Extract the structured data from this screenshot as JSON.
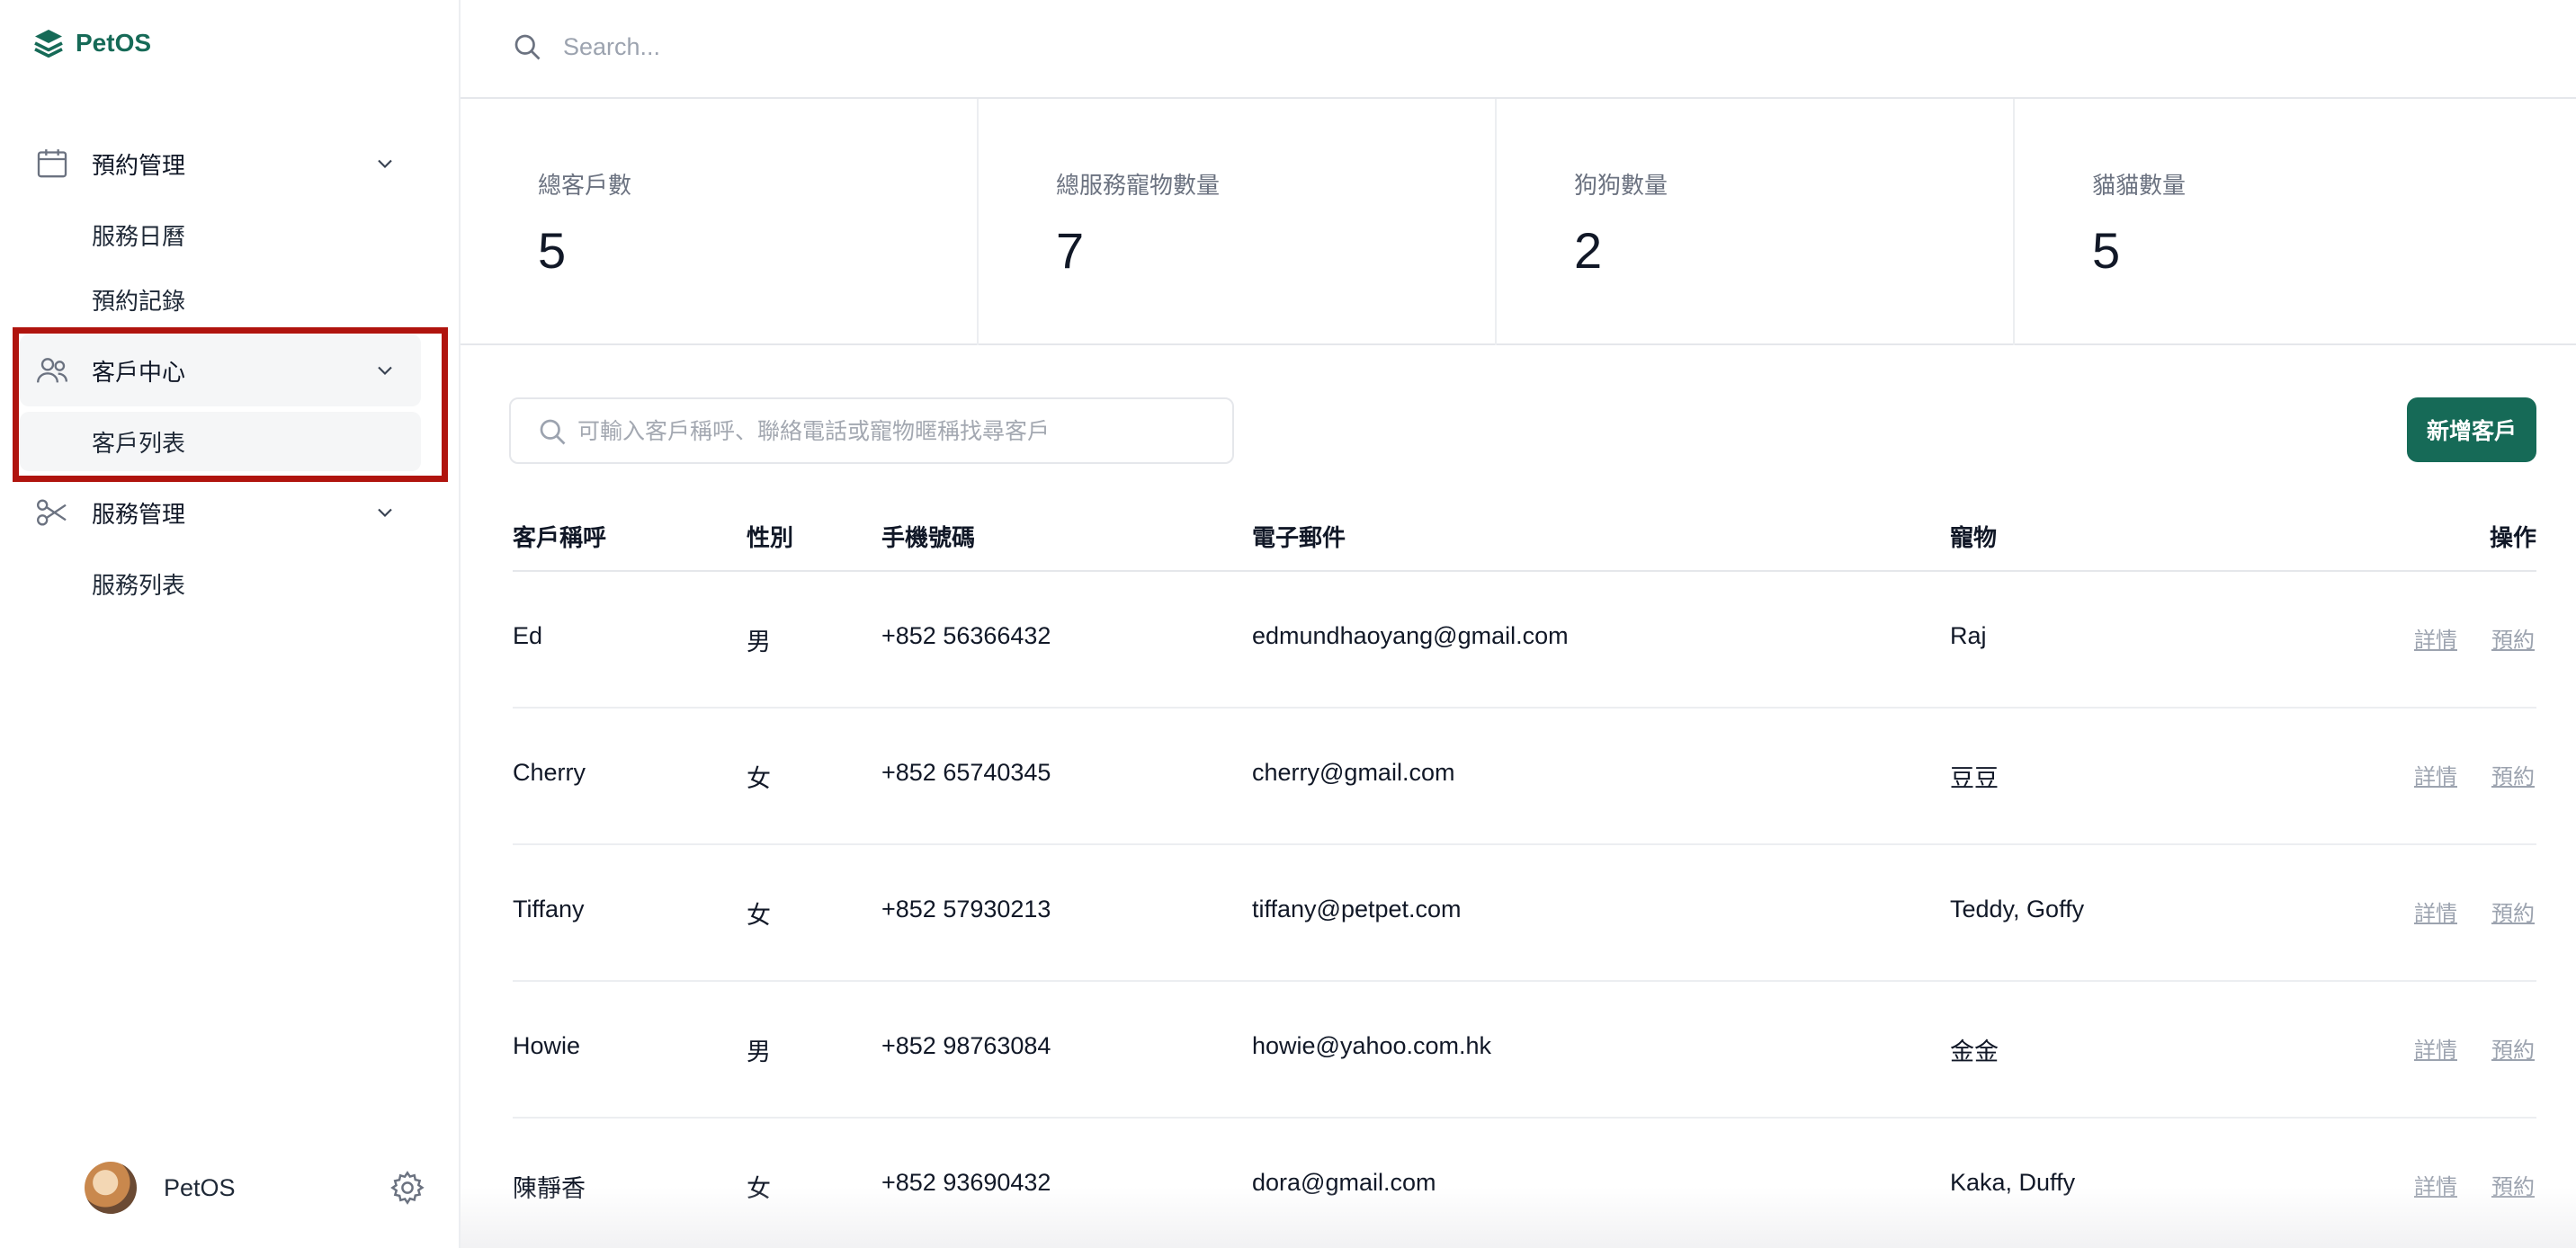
{
  "app": {
    "name": "PetOS"
  },
  "sidebar": {
    "groups": [
      {
        "label": "預約管理",
        "icon": "calendar-icon",
        "items": [
          "服務日曆",
          "預約記錄"
        ]
      },
      {
        "label": "客戶中心",
        "icon": "users-icon",
        "items": [
          "客戶列表"
        ]
      },
      {
        "label": "服務管理",
        "icon": "scissors-icon",
        "items": [
          "服務列表"
        ]
      }
    ],
    "user": {
      "name": "PetOS"
    }
  },
  "topbar": {
    "search_placeholder": "Search..."
  },
  "stats": [
    {
      "label": "總客戶數",
      "value": "5"
    },
    {
      "label": "總服務寵物數量",
      "value": "7"
    },
    {
      "label": "狗狗數量",
      "value": "2"
    },
    {
      "label": "貓貓數量",
      "value": "5"
    }
  ],
  "customers": {
    "filter_placeholder": "可輸入客戶稱呼、聯絡電話或寵物暱稱找尋客戶",
    "add_button": "新增客戶",
    "columns": [
      "客戶稱呼",
      "性別",
      "手機號碼",
      "電子郵件",
      "寵物",
      "操作"
    ],
    "actions": {
      "detail": "詳情",
      "book": "預約"
    },
    "rows": [
      {
        "name": "Ed",
        "gender": "男",
        "phone": "+852 56366432",
        "email": "edmundhaoyang@gmail.com",
        "pets": "Raj"
      },
      {
        "name": "Cherry",
        "gender": "女",
        "phone": "+852 65740345",
        "email": "cherry@gmail.com",
        "pets": "豆豆"
      },
      {
        "name": "Tiffany",
        "gender": "女",
        "phone": "+852 57930213",
        "email": "tiffany@petpet.com",
        "pets": "Teddy, Goffy"
      },
      {
        "name": "Howie",
        "gender": "男",
        "phone": "+852 98763084",
        "email": "howie@yahoo.com.hk",
        "pets": "金金"
      },
      {
        "name": "陳靜香",
        "gender": "女",
        "phone": "+852 93690432",
        "email": "dora@gmail.com",
        "pets": "Kaka, Duffy"
      }
    ]
  },
  "colors": {
    "brand": "#166a57",
    "highlight": "#b0140e"
  }
}
